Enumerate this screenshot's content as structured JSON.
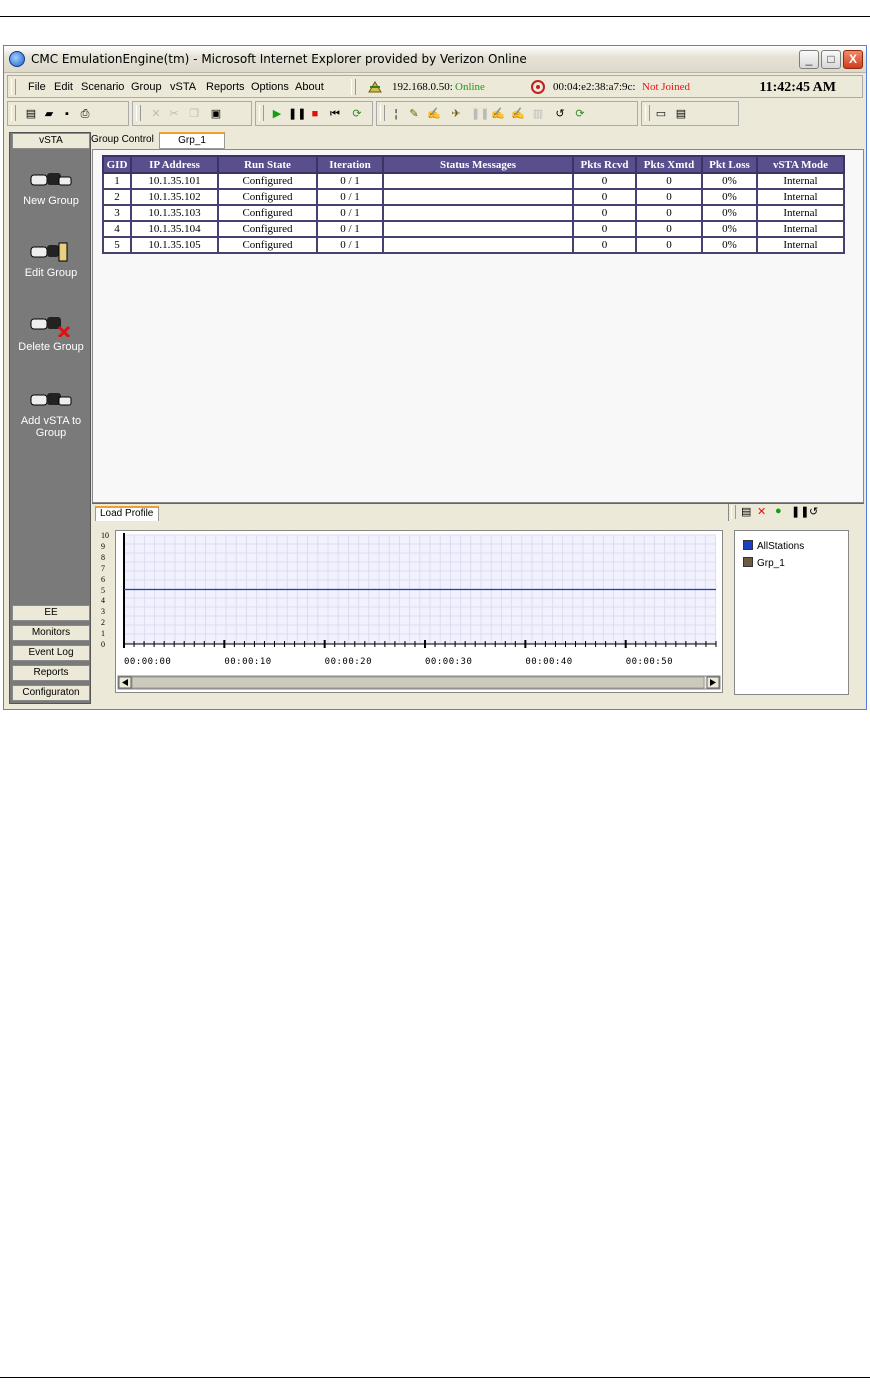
{
  "window": {
    "title": "CMC EmulationEngine(tm) - Microsoft Internet Explorer provided by Verizon Online",
    "min_label": "_",
    "max_label": "□",
    "close_label": "X"
  },
  "menu": {
    "items": [
      "File",
      "Edit",
      "Scenario",
      "Group",
      "vSTA",
      "Reports",
      "Options",
      "About"
    ],
    "ip_prefix": "192.168.0.50:",
    "ip_status": "Online",
    "mac_prefix": "00:04:e2:38:a7:9c:",
    "mac_status": "Not Joined",
    "clock": "11:42:45 AM"
  },
  "toolbar": {
    "file_icons": [
      "new-icon",
      "open-icon",
      "save-icon",
      "print-icon"
    ],
    "edit_icons": [
      "cut-icon",
      "scissors-icon",
      "copy-icon",
      "paste-icon"
    ],
    "run_icons": [
      "play-icon",
      "pause-icon",
      "stop-icon",
      "rewind-icon",
      "refresh-icon"
    ],
    "vsta_icons": [
      "probe-icon",
      "add-sta-icon",
      "edit-sta-icon",
      "run-sta-icon",
      "pause-sta-icon",
      "disabled-sta-icon",
      "disabled-sta2-icon",
      "disabled-sta3-icon",
      "reset-icon",
      "reload-icon"
    ],
    "extra_icons": [
      "report-icon",
      "export-icon"
    ]
  },
  "sidebar": {
    "header": "vSTA",
    "items": [
      {
        "label": "New Group",
        "icon": "new-group-icon"
      },
      {
        "label": "Edit Group",
        "icon": "edit-group-icon"
      },
      {
        "label": "Delete Group",
        "icon": "delete-group-icon"
      },
      {
        "label": "Add vSTA to Group",
        "icon": "add-vsta-icon"
      }
    ],
    "bottom_tabs": [
      "EE",
      "Monitors",
      "Event Log",
      "Reports",
      "Configuraton"
    ]
  },
  "tabs": {
    "group_control": "Group Control",
    "active": "Grp_1"
  },
  "table": {
    "columns": [
      "GID",
      "IP Address",
      "Run State",
      "Iteration",
      "Status Messages",
      "Pkts Rcvd",
      "Pkts Xmtd",
      "Pkt Loss",
      "vSTA Mode"
    ],
    "rows": [
      [
        "1",
        "10.1.35.101",
        "Configured",
        "0 / 1",
        "",
        "0",
        "0",
        "0%",
        "Internal"
      ],
      [
        "2",
        "10.1.35.102",
        "Configured",
        "0 / 1",
        "",
        "0",
        "0",
        "0%",
        "Internal"
      ],
      [
        "3",
        "10.1.35.103",
        "Configured",
        "0 / 1",
        "",
        "0",
        "0",
        "0%",
        "Internal"
      ],
      [
        "4",
        "10.1.35.104",
        "Configured",
        "0 / 1",
        "",
        "0",
        "0",
        "0%",
        "Internal"
      ],
      [
        "5",
        "10.1.35.105",
        "Configured",
        "0 / 1",
        "",
        "0",
        "0",
        "0%",
        "Internal"
      ]
    ]
  },
  "load_profile": {
    "tab_label": "Load Profile",
    "tool_icons": [
      "new-icon",
      "delete-icon",
      "play-icon",
      "pause-icon",
      "reset-icon"
    ]
  },
  "chart_data": {
    "type": "line",
    "ylim": [
      0,
      10
    ],
    "y_ticks": [
      "0",
      "1",
      "2",
      "3",
      "4",
      "5",
      "6",
      "7",
      "8",
      "9",
      "10"
    ],
    "x_ticks": [
      "00:00:00",
      "00:00:10",
      "00:00:20",
      "00:00:30",
      "00:00:40",
      "00:00:50"
    ],
    "xlim": [
      0,
      59
    ],
    "grid": true,
    "series": [
      {
        "name": "AllStations",
        "color": "#1a3fc0",
        "x": [
          0,
          59
        ],
        "values": [
          5,
          5
        ]
      },
      {
        "name": "Grp_1",
        "color": "#6b5a44",
        "x": [],
        "values": []
      }
    ],
    "legend_position": "right"
  }
}
